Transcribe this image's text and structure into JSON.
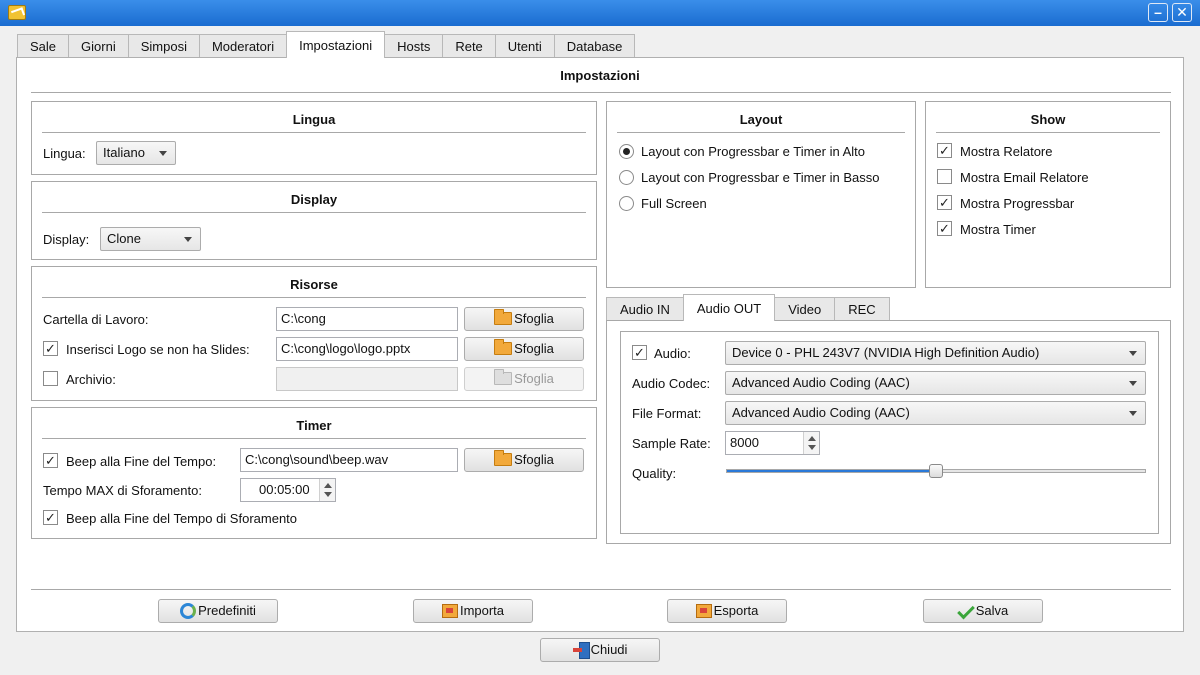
{
  "window": {
    "minimize_glyph": "–",
    "close_glyph": "✕"
  },
  "tabs": [
    {
      "label": "Sale"
    },
    {
      "label": "Giorni"
    },
    {
      "label": "Simposi"
    },
    {
      "label": "Moderatori"
    },
    {
      "label": "Impostazioni",
      "active": true
    },
    {
      "label": "Hosts"
    },
    {
      "label": "Rete"
    },
    {
      "label": "Utenti"
    },
    {
      "label": "Database"
    }
  ],
  "page_title": "Impostazioni",
  "lingua": {
    "title": "Lingua",
    "label": "Lingua:",
    "value": "Italiano"
  },
  "display": {
    "title": "Display",
    "label": "Display:",
    "value": "Clone"
  },
  "risorse": {
    "title": "Risorse",
    "cartella_label": "Cartella di Lavoro:",
    "cartella_value": "C:\\cong",
    "logo_label": "Inserisci Logo se non ha Slides:",
    "logo_value": "C:\\cong\\logo\\logo.pptx",
    "logo_checked": true,
    "archivio_label": "Archivio:",
    "archivio_value": "",
    "archivio_checked": false,
    "browse_label": "Sfoglia"
  },
  "timer": {
    "title": "Timer",
    "beep_label": "Beep alla Fine del Tempo:",
    "beep_value": "C:\\cong\\sound\\beep.wav",
    "beep_checked": true,
    "max_label": "Tempo MAX di Sforamento:",
    "max_value": "00:05:00",
    "beep_over_label": "Beep alla Fine del Tempo di Sforamento",
    "beep_over_checked": true,
    "browse_label": "Sfoglia"
  },
  "layout": {
    "title": "Layout",
    "options": [
      {
        "label": "Layout con Progressbar e Timer in Alto",
        "selected": true
      },
      {
        "label": "Layout con Progressbar e Timer in Basso",
        "selected": false
      },
      {
        "label": "Full Screen",
        "selected": false
      }
    ]
  },
  "show": {
    "title": "Show",
    "options": [
      {
        "label": "Mostra Relatore",
        "checked": true
      },
      {
        "label": "Mostra Email Relatore",
        "checked": false
      },
      {
        "label": "Mostra Progressbar",
        "checked": true
      },
      {
        "label": "Mostra Timer",
        "checked": true
      }
    ]
  },
  "audio_tabs": [
    {
      "label": "Audio IN"
    },
    {
      "label": "Audio OUT",
      "active": true
    },
    {
      "label": "Video"
    },
    {
      "label": "REC"
    }
  ],
  "audio_out": {
    "audio_label": "Audio:",
    "audio_checked": true,
    "audio_value": "Device 0 - PHL 243V7 (NVIDIA High Definition Audio)",
    "codec_label": "Audio Codec:",
    "codec_value": "Advanced Audio Coding (AAC)",
    "format_label": "File Format:",
    "format_value": "Advanced Audio Coding (AAC)",
    "rate_label": "Sample Rate:",
    "rate_value": "8000",
    "quality_label": "Quality:",
    "quality_fraction": 0.5
  },
  "footer": {
    "predefiniti": "Predefiniti",
    "importa": "Importa",
    "esporta": "Esporta",
    "salva": "Salva",
    "chiudi": "Chiudi"
  },
  "check_glyph": "✓"
}
